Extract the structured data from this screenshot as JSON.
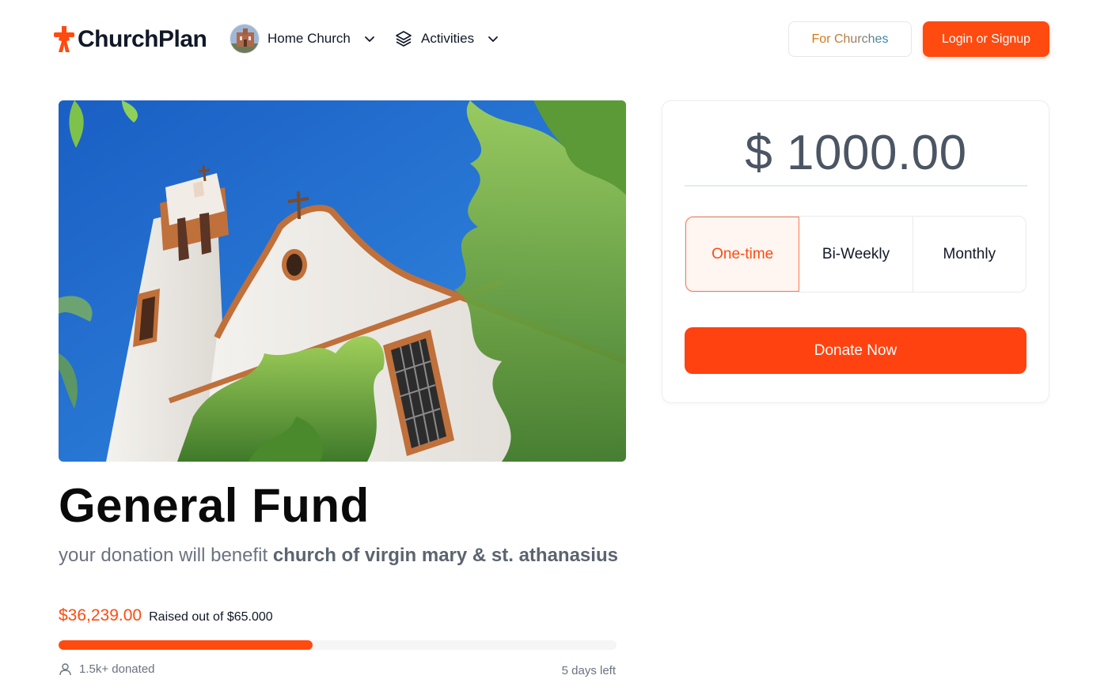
{
  "header": {
    "logo_text": "ChurchPlan",
    "nav": {
      "home_church_label": "Home Church",
      "activities_label": "Activities"
    },
    "for_churches_label": "For Churches",
    "login_label": "Login or Signup"
  },
  "fund": {
    "title": "General Fund",
    "subtitle_prefix": "your donation will benefit ",
    "beneficiary": "church of virgin mary & st. athanasius",
    "raised_amount": "$36,239.00",
    "raised_of": "Raised out of $65.000",
    "progress_fraction": 0.455,
    "donors": "1.5k+ donated",
    "days_left": "5 days left"
  },
  "donation": {
    "amount": "$ 1000.00",
    "frequencies": [
      "One-time",
      "Bi-Weekly",
      "Monthly"
    ],
    "selected_frequency": "One-time",
    "donate_label": "Donate Now"
  },
  "colors": {
    "accent": "#ff4a10",
    "text": "#111827",
    "muted": "#6b7280"
  }
}
